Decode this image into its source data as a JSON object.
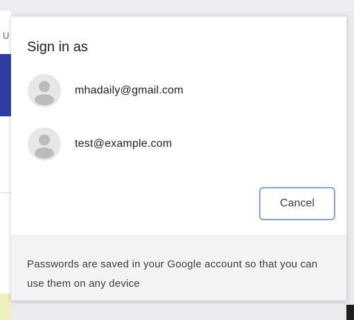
{
  "background": {
    "left_partial_text": "U"
  },
  "dialog": {
    "title": "Sign in as",
    "accounts": [
      {
        "email": "mhadaily@gmail.com",
        "icon": "person-avatar-icon"
      },
      {
        "email": "test@example.com",
        "icon": "person-avatar-icon"
      }
    ],
    "cancel_label": "Cancel",
    "footer_text": "Passwords are saved in your Google account so that you can use them on any device"
  },
  "colors": {
    "button_border": "#8aa4c9",
    "footer_bg": "#f1f3f4",
    "avatar_bg": "#e6e7e9",
    "avatar_fg": "#b9bbbe",
    "background_accent": "#2f3da0"
  }
}
